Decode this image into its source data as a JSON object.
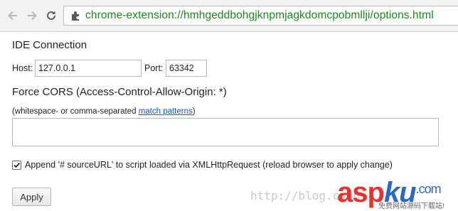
{
  "browser": {
    "url": "chrome-extension://hmhgeddbohgjknpmjagkdomcpobmllji/options.html",
    "url_color": "#1a8a1a",
    "icons": [
      "back-arrow-icon",
      "forward-arrow-icon",
      "reload-icon",
      "extension-icon"
    ]
  },
  "ide_connection": {
    "heading": "IDE Connection",
    "host_label": "Host:",
    "host_value": "127.0.0.1",
    "port_label": "Port:",
    "port_value": "63342"
  },
  "cors": {
    "heading": "Force CORS (Access-Control-Allow-Origin: *)",
    "hint_prefix": "(whitespace- or comma-separated ",
    "hint_link": "match patterns",
    "hint_suffix": ")",
    "value": ""
  },
  "source_url": {
    "checked": true,
    "label": "Append '# sourceURL' to script loaded via XMLHttpRequest (reload browser to apply change)"
  },
  "apply_button": "Apply",
  "watermark": {
    "url": "http://blog.csdn.",
    "logo_part1": "asp",
    "logo_part2": "ku",
    "logo_part3": ".com",
    "subtitle": "免费网站源码下载站!"
  }
}
